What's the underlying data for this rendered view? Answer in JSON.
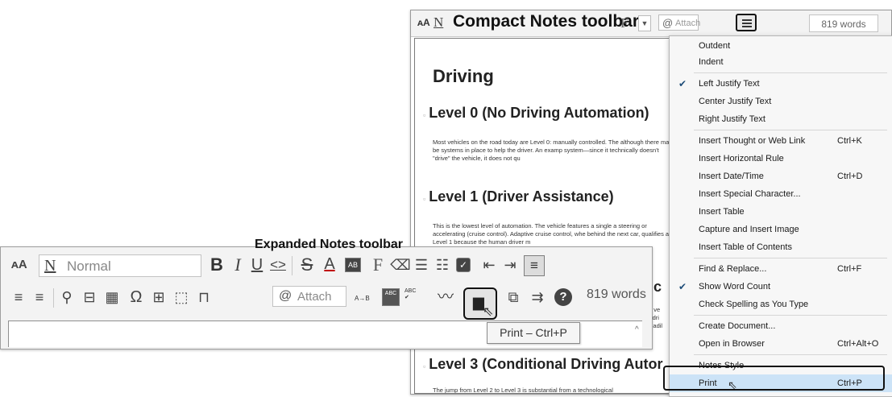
{
  "compact_toolbar": {
    "font_size_icon": "ᴀA",
    "normal_icon": "N",
    "title": "Compact Notes toolbar",
    "font_icon": "F",
    "attach_label": "Attach",
    "word_count": "819 words"
  },
  "document": {
    "heading": "Driving",
    "sections": [
      {
        "title": "Level 0 (No Driving Automation)",
        "text": "Most vehicles on the road today are Level 0: manually controlled. The although there may be systems in place to help the driver. An examp system—since it technically doesn't \"drive\" the vehicle, it does not qu"
      },
      {
        "title": "Level 1 (Driver Assistance)",
        "text": "This is the lowest level of automation. The vehicle features a single a steering or accelerating (cruise control). Adaptive cruise control, whe behind the next car, qualifies as Level 1 because the human driver m"
      },
      {
        "title": "Level 3 (Conditional Driving Autor",
        "text": "The jump from Level 2 to Level 3 is substantial from a technological"
      }
    ],
    "partial_heading": "tic",
    "partial_lines": [
      "e ve",
      "f-dri",
      "Cadil"
    ]
  },
  "menu": {
    "items": [
      {
        "label": "Outdent",
        "shortcut": "",
        "checked": false
      },
      {
        "label": "Indent",
        "shortcut": "",
        "checked": false
      },
      {
        "label": "Left Justify Text",
        "shortcut": "",
        "checked": true
      },
      {
        "label": "Center Justify Text",
        "shortcut": "",
        "checked": false
      },
      {
        "label": "Right Justify Text",
        "shortcut": "",
        "checked": false
      },
      {
        "label": "Insert Thought or Web Link",
        "shortcut": "Ctrl+K",
        "checked": false
      },
      {
        "label": "Insert Horizontal Rule",
        "shortcut": "",
        "checked": false
      },
      {
        "label": "Insert Date/Time",
        "shortcut": "Ctrl+D",
        "checked": false
      },
      {
        "label": "Insert Special Character...",
        "shortcut": "",
        "checked": false
      },
      {
        "label": "Insert Table",
        "shortcut": "",
        "checked": false
      },
      {
        "label": "Capture and Insert Image",
        "shortcut": "",
        "checked": false
      },
      {
        "label": "Insert Table of Contents",
        "shortcut": "",
        "checked": false
      },
      {
        "label": "Find & Replace...",
        "shortcut": "Ctrl+F",
        "checked": false
      },
      {
        "label": "Show Word Count",
        "shortcut": "",
        "checked": true
      },
      {
        "label": "Check Spelling as You Type",
        "shortcut": "",
        "checked": false
      },
      {
        "label": "Create Document...",
        "shortcut": "",
        "checked": false
      },
      {
        "label": "Open in Browser",
        "shortcut": "Ctrl+Alt+O",
        "checked": false
      },
      {
        "label": "Notes Style",
        "shortcut": "",
        "checked": false
      },
      {
        "label": "Print",
        "shortcut": "Ctrl+P",
        "checked": false
      }
    ]
  },
  "expanded_toolbar": {
    "title": "Expanded Notes toolbar",
    "font_size_icon": "ᴀA",
    "style_icon": "N",
    "style_value": "Normal",
    "attach_label": "Attach",
    "word_count": "819 words",
    "tooltip": "Print – Ctrl+P",
    "find_replace_icon_text": "A→B",
    "spell_icon_text_1": "ABC",
    "spell_icon_text_2": "ABC",
    "highlight_icon_text": "AB",
    "font_icon": "F"
  }
}
